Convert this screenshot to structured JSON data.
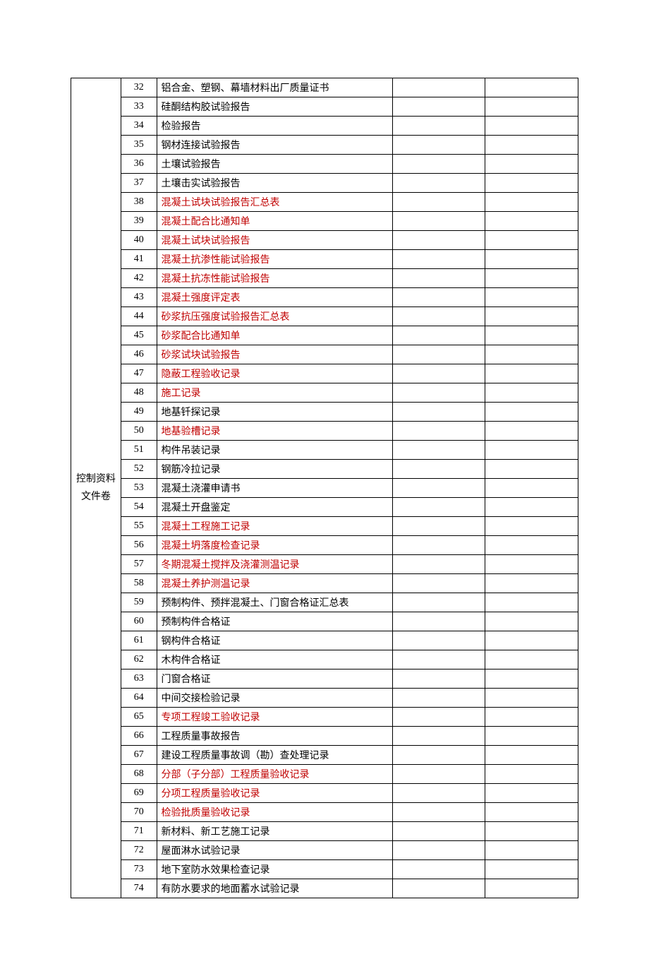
{
  "category": "控制资料文件卷",
  "rows": [
    {
      "num": 32,
      "desc": "铝合金、塑钢、幕墙材料出厂质量证书",
      "red": false
    },
    {
      "num": 33,
      "desc": "硅酮结构胶试验报告",
      "red": false
    },
    {
      "num": 34,
      "desc": "检验报告",
      "red": false
    },
    {
      "num": 35,
      "desc": "钢材连接试验报告",
      "red": false
    },
    {
      "num": 36,
      "desc": "土壤试验报告",
      "red": false
    },
    {
      "num": 37,
      "desc": "土壤击实试验报告",
      "red": false
    },
    {
      "num": 38,
      "desc": "混凝土试块试验报告汇总表",
      "red": true
    },
    {
      "num": 39,
      "desc": "混凝土配合比通知单",
      "red": true
    },
    {
      "num": 40,
      "desc": "混凝土试块试验报告",
      "red": true
    },
    {
      "num": 41,
      "desc": "混凝土抗渗性能试验报告",
      "red": true
    },
    {
      "num": 42,
      "desc": "混凝土抗冻性能试验报告",
      "red": true
    },
    {
      "num": 43,
      "desc": "混凝土强度评定表",
      "red": true
    },
    {
      "num": 44,
      "desc": "砂浆抗压强度试验报告汇总表",
      "red": true
    },
    {
      "num": 45,
      "desc": "砂浆配合比通知单",
      "red": true
    },
    {
      "num": 46,
      "desc": "砂浆试块试验报告",
      "red": true
    },
    {
      "num": 47,
      "desc": "隐蔽工程验收记录",
      "red": true
    },
    {
      "num": 48,
      "desc": "施工记录",
      "red": true
    },
    {
      "num": 49,
      "desc": "地基钎探记录",
      "red": false
    },
    {
      "num": 50,
      "desc": "地基验槽记录",
      "red": true
    },
    {
      "num": 51,
      "desc": "构件吊装记录",
      "red": false
    },
    {
      "num": 52,
      "desc": "钢筋冷拉记录",
      "red": false
    },
    {
      "num": 53,
      "desc": "混凝土浇灌申请书",
      "red": false
    },
    {
      "num": 54,
      "desc": "混凝土开盘鉴定",
      "red": false
    },
    {
      "num": 55,
      "desc": "混凝土工程施工记录",
      "red": true
    },
    {
      "num": 56,
      "desc": "混凝土坍落度检查记录",
      "red": true
    },
    {
      "num": 57,
      "desc": "冬期混凝土搅拌及浇灌测温记录",
      "red": true
    },
    {
      "num": 58,
      "desc": "混凝土养护测温记录",
      "red": true
    },
    {
      "num": 59,
      "desc": "预制构件、预拌混凝土、门窗合格证汇总表",
      "red": false
    },
    {
      "num": 60,
      "desc": "预制构件合格证",
      "red": false
    },
    {
      "num": 61,
      "desc": "钢构件合格证",
      "red": false
    },
    {
      "num": 62,
      "desc": "木构件合格证",
      "red": false
    },
    {
      "num": 63,
      "desc": "门窗合格证",
      "red": false
    },
    {
      "num": 64,
      "desc": "中间交接检验记录",
      "red": false
    },
    {
      "num": 65,
      "desc": "专项工程竣工验收记录",
      "red": true
    },
    {
      "num": 66,
      "desc": "工程质量事故报告",
      "red": false
    },
    {
      "num": 67,
      "desc": "建设工程质量事故调（勘）查处理记录",
      "red": false
    },
    {
      "num": 68,
      "desc": "分部（子分部）工程质量验收记录",
      "red": true
    },
    {
      "num": 69,
      "desc": "分项工程质量验收记录",
      "red": true
    },
    {
      "num": 70,
      "desc": "检验批质量验收记录",
      "red": true
    },
    {
      "num": 71,
      "desc": "新材料、新工艺施工记录",
      "red": false
    },
    {
      "num": 72,
      "desc": "屋面淋水试验记录",
      "red": false
    },
    {
      "num": 73,
      "desc": "地下室防水效果检查记录",
      "red": false
    },
    {
      "num": 74,
      "desc": "有防水要求的地面蓄水试验记录",
      "red": false
    }
  ]
}
